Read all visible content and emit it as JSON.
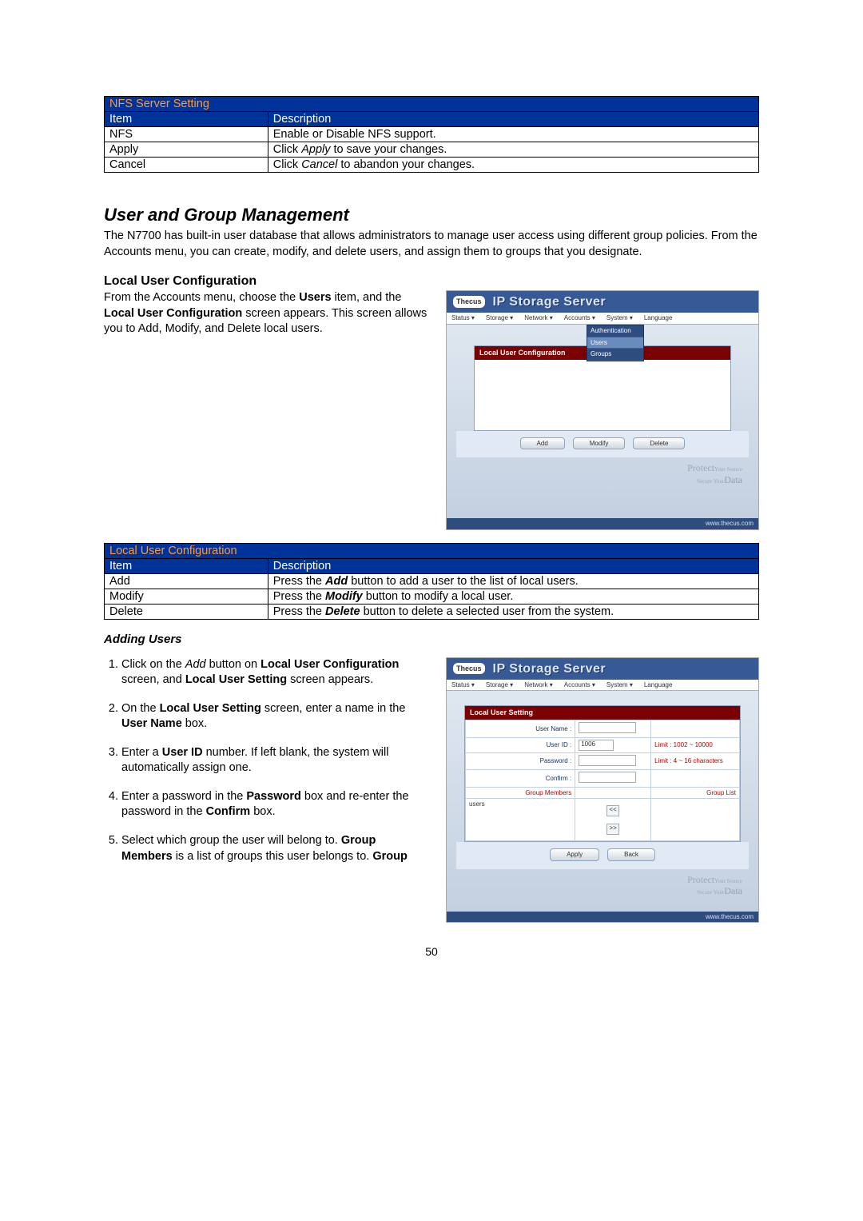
{
  "page_number": "50",
  "nfs_table": {
    "title": "NFS Server Setting",
    "head_item": "Item",
    "head_desc": "Description",
    "rows": [
      {
        "item": "NFS",
        "desc_pre": "Enable or Disable NFS support.",
        "desc_em": "",
        "desc_post": ""
      },
      {
        "item": "Apply",
        "desc_pre": "Click ",
        "desc_em": "Apply",
        "desc_post": " to save your changes."
      },
      {
        "item": "Cancel",
        "desc_pre": "Click ",
        "desc_em": "Cancel",
        "desc_post": " to abandon your changes."
      }
    ]
  },
  "section_title": "User and Group Management",
  "section_intro": "The N7700 has built-in user database that allows administrators to manage user access using different group policies. From the Accounts menu, you can create, modify, and delete users, and assign them to groups that you designate.",
  "local_user_heading": "Local User Configuration",
  "local_user_para_pre": "From the Accounts menu, choose the ",
  "local_user_para_em1": "Users",
  "local_user_para_mid": " item, and the ",
  "local_user_para_em2": "Local User Configuration",
  "local_user_para_post": " screen appears. This screen allows you to Add, Modify, and Delete local users.",
  "local_table": {
    "title": "Local User Configuration",
    "head_item": "Item",
    "head_desc": "Description",
    "rows": [
      {
        "item": "Add",
        "desc_pre": "Press the ",
        "desc_em": "Add",
        "desc_post": " button to add a user to the list of local users."
      },
      {
        "item": "Modify",
        "desc_pre": "Press the ",
        "desc_em": "Modify",
        "desc_post": " button to modify a local user."
      },
      {
        "item": "Delete",
        "desc_pre": "Press the ",
        "desc_em": "Delete",
        "desc_post": " button to delete a selected user from the system."
      }
    ]
  },
  "adding_users_heading": "Adding Users",
  "steps": [
    "Click on the <i>Add</i> button on <b>Local User Configuration</b> screen, and <b>Local User Setting</b> screen appears.",
    "On the <b>Local User Setting</b> screen, enter a name in the <b>User Name</b> box.",
    "Enter a <b>User ID</b> number. If left blank, the system will automatically assign one.",
    "Enter a password in the <b>Password</b> box and re-enter the password in the <b>Confirm</b> box.",
    "Select which group the user will belong to. <b>Group Members</b> is a list of groups this user belongs to. <b>Group</b>"
  ],
  "mock1": {
    "logo": "Thecus",
    "title": "IP Storage Server",
    "menu": [
      "Status ▾",
      "Storage ▾",
      "Network ▾",
      "Accounts ▾",
      "System ▾",
      "Language"
    ],
    "dropdown": [
      "Authentication",
      "Users",
      "Groups"
    ],
    "panel_title": "Local User Configuration",
    "buttons": [
      "Add",
      "Modify",
      "Delete"
    ],
    "footer_main": "Protect",
    "footer_sub": "Your Source",
    "footer_sub2": "Secure Your",
    "footer_data": "Data",
    "url": "www.thecus.com"
  },
  "mock2": {
    "panel_title": "Local User Setting",
    "labels": {
      "username": "User Name :",
      "userid": "User ID :",
      "userid_val": "1006",
      "userid_limit": "Limit : 1002 ~ 10000",
      "password": "Password :",
      "password_limit": "Limit : 4 ~ 16 characters",
      "confirm": "Confirm :",
      "group_members": "Group Members",
      "group_list": "Group List",
      "users_entry": "users",
      "apply": "Apply",
      "back": "Back"
    }
  }
}
